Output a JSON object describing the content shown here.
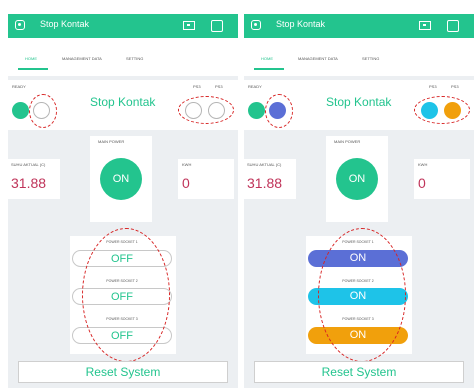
{
  "caption": {
    "fragment": ""
  },
  "app": {
    "title": "Stop Kontak"
  },
  "tabs": [
    {
      "label": "HOME"
    },
    {
      "label": "MANAGEMENT DATA"
    },
    {
      "label": "SETTING"
    }
  ],
  "widgets": {
    "ready_label": "READY",
    "title": "Stop Kontak",
    "led_right_labels": [
      "PS3",
      "PS3"
    ],
    "main_power_label": "MAIN POWER",
    "main_power_value": "ON",
    "temp_label": "SUHU AKTUAL (C)",
    "temp_value": "31.88",
    "kwh_label": "KWH",
    "kwh_value": "0",
    "socket_labels": [
      "POWER SOCKET 1",
      "POWER SOCKET 2",
      "POWER SOCKET 3"
    ],
    "reset_label": "Reset System"
  },
  "left_state": {
    "sockets": [
      "OFF",
      "OFF",
      "OFF"
    ]
  },
  "right_state": {
    "sockets": [
      "ON",
      "ON",
      "ON"
    ]
  },
  "colors": {
    "brand": "#23c48e",
    "value_red": "#c0345a",
    "socket1_on": "#5b6fd6",
    "socket2_on": "#1ec3e8",
    "socket3_on": "#f1a00c",
    "annotation": "#d72424"
  }
}
